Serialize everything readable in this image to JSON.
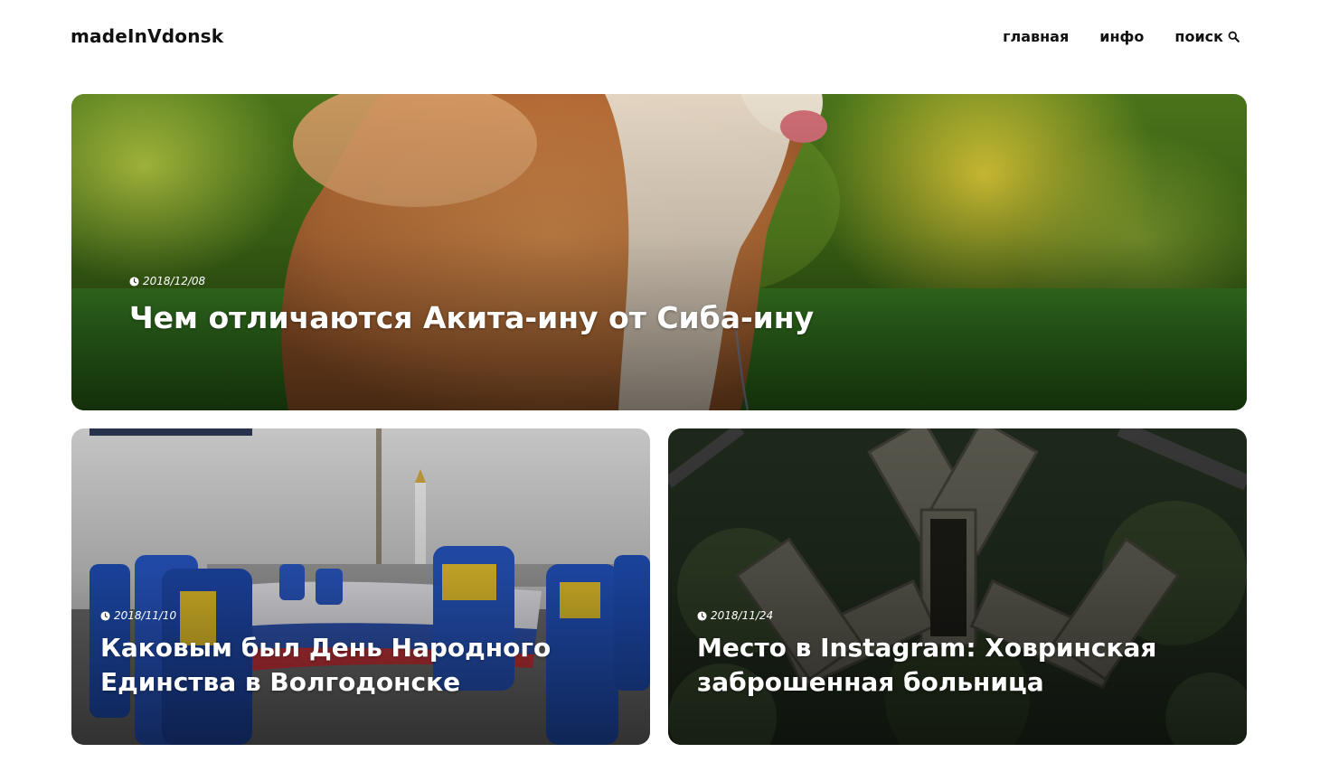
{
  "header": {
    "logo": "madeInVdonsk",
    "nav": {
      "home": "главная",
      "info": "инфо",
      "search": "поиск",
      "search_icon": "search-icon"
    }
  },
  "featured": {
    "date": "2018/12/08",
    "title": "Чем отличаются Акита-ину от Сиба-ину",
    "image": "akita-dog-on-grass-photo"
  },
  "posts": [
    {
      "date": "2018/11/10",
      "title": "Каковым был День Народного Единства в Волгодонске",
      "image": "people-in-blue-jackets-with-flag-photo"
    },
    {
      "date": "2018/11/24",
      "title": "Место в Instagram: Ховринская заброшенная больница",
      "image": "aerial-abandoned-hospital-photo"
    }
  ],
  "colors": {
    "text": "#111111",
    "background": "#ffffff",
    "overlay_text": "#ffffff"
  }
}
